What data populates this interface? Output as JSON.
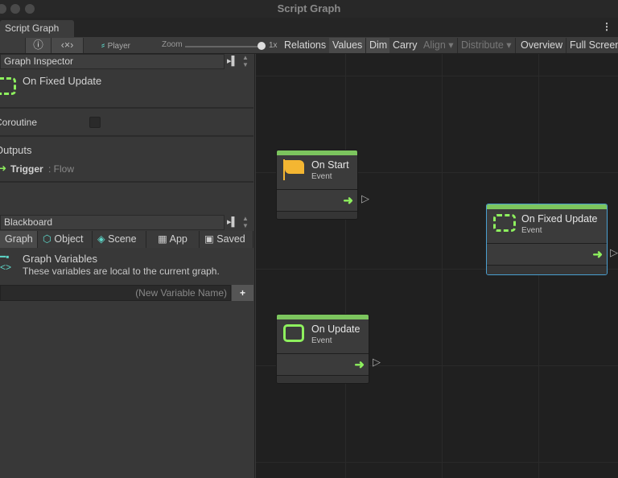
{
  "window": {
    "title": "Script Graph",
    "tab": "Script Graph",
    "menu_icon": "kebab-menu-icon"
  },
  "toolbar": {
    "player": "Player",
    "zoom_label": "Zoom",
    "zoom_value": "1x",
    "zoom_level": 1.0,
    "buttons": [
      "Relations",
      "Values",
      "Dim",
      "Carry",
      "Align ▾",
      "Distribute ▾",
      "Overview",
      "Full Screen"
    ]
  },
  "inspector": {
    "title": "Graph Inspector",
    "node_title": "On Fixed Update",
    "coroutine_label": "Coroutine",
    "coroutine_checked": false,
    "outputs_label": "Outputs",
    "trigger_name": "Trigger",
    "trigger_type": ": Flow"
  },
  "blackboard": {
    "title": "Blackboard",
    "tabs": [
      "Graph",
      "Object",
      "Scene",
      "App",
      "Saved"
    ],
    "section_title": "Graph Variables",
    "section_desc": "These variables are local to the current graph.",
    "new_var_placeholder": "(New Variable Name)",
    "add_label": "+"
  },
  "nodes": [
    {
      "title": "On Start",
      "subtitle": "Event",
      "icon": "flag-icon"
    },
    {
      "title": "On Update",
      "subtitle": "Event",
      "icon": "loop-icon"
    },
    {
      "title": "On Fixed Update",
      "subtitle": "Event",
      "icon": "fixed-loop-icon",
      "selected": true
    }
  ],
  "colors": {
    "accent_green": "#7cc55e",
    "flow_arrow": "#8ef05e",
    "selection": "#4a9fd0",
    "flag": "#f4b632"
  }
}
